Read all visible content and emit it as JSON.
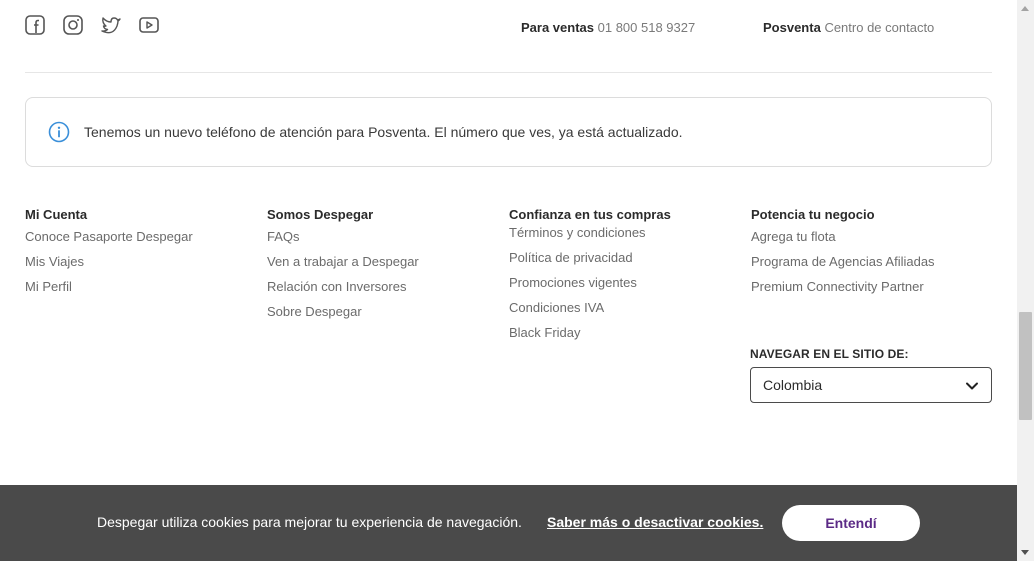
{
  "social": [
    {
      "icon": "facebook-icon"
    },
    {
      "icon": "instagram-icon"
    },
    {
      "icon": "twitter-icon"
    },
    {
      "icon": "youtube-icon"
    }
  ],
  "contact": {
    "sales_label": "Para ventas",
    "sales_phone": "01 800 518 9327",
    "postsale_label": "Posventa",
    "postsale_link": "Centro de contacto"
  },
  "notice": {
    "icon": "info-icon",
    "text": "Tenemos un nuevo teléfono de atención para Posventa. El número que ves, ya está actualizado.",
    "accent": "#3a8fd9"
  },
  "columns": [
    {
      "title": "Mi Cuenta",
      "links": [
        "Conoce Pasaporte Despegar",
        "Mis Viajes",
        "Mi Perfil"
      ]
    },
    {
      "title": "Somos Despegar",
      "links": [
        "FAQs",
        "Ven a trabajar a Despegar",
        "Relación con Inversores",
        "Sobre Despegar"
      ]
    },
    {
      "title": "Confianza en tus compras",
      "links": [
        "Términos y condiciones",
        "Política de privacidad",
        "Promociones vigentes",
        "Condiciones IVA",
        "Black Friday"
      ]
    },
    {
      "title": "Potencia tu negocio",
      "links": [
        "Agrega tu flota",
        "Programa de Agencias Afiliadas",
        "Premium Connectivity Partner"
      ]
    }
  ],
  "site_selector": {
    "label": "NAVEGAR EN EL SITIO DE:",
    "value": "Colombia"
  },
  "cookies": {
    "message": "Despegar utiliza cookies para mejorar tu experiencia de navegación.",
    "more_link": "Saber más o desactivar cookies.",
    "accept": "Entendí",
    "accept_color": "#5b2a86"
  }
}
